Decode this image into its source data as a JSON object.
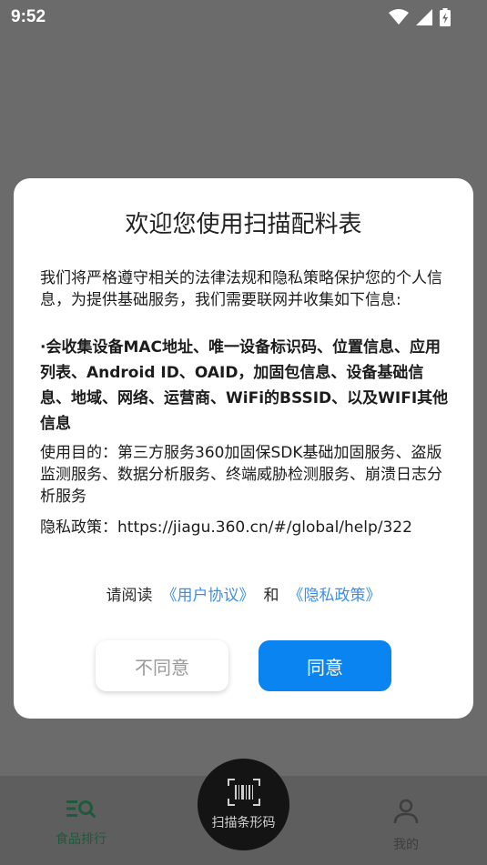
{
  "status_bar": {
    "time": "9:52",
    "icons": [
      "wifi-icon",
      "signal-icon",
      "battery-charging-icon"
    ]
  },
  "dialog": {
    "title": "欢迎您使用扫描配料表",
    "intro": "我们将严格遵守相关的法律法规和隐私策略保护您的个人信息，为提供基础服务，我们需要联网并收集如下信息:",
    "collect": "·会收集设备MAC地址、唯一设备标识码、位置信息、应用列表、Android ID、OAID，加固包信息、设备基础信息、地域、网络、运营商、WiFi的BSSID、以及WIFI其他信息",
    "purpose": "使用目的：第三方服务360加固保SDK基础加固服务、盗版监测服务、数据分析服务、终端威胁检测服务、崩溃日志分析服务",
    "policy": "隐私政策：https://jiagu.360.cn/#/global/help/322",
    "agreement": {
      "prefix": "请阅读",
      "user_agreement": "《用户协议》",
      "and": "和",
      "privacy_policy": "《隐私政策》"
    },
    "disagree_label": "不同意",
    "agree_label": "同意"
  },
  "bottom_nav": {
    "food_ranking_label": "食品排行",
    "scan_label": "扫描条形码",
    "mine_label": "我的"
  },
  "colors": {
    "overlay": "#6b6b6b",
    "accent": "#0a84f0",
    "link": "#3c8fe6",
    "nav_active": "#1f5a3c"
  }
}
